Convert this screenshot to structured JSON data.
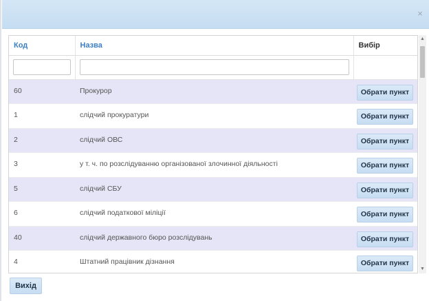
{
  "dialog": {
    "close_glyph": "×"
  },
  "table": {
    "headers": {
      "code": "Код",
      "name": "Назва",
      "choice": "Вибір"
    },
    "filters": {
      "code_value": "",
      "name_value": ""
    },
    "rows": [
      {
        "code": "60",
        "name": "Прокурор",
        "button": "Обрати пункт"
      },
      {
        "code": "1",
        "name": "слідчий прокуратури",
        "button": "Обрати пункт"
      },
      {
        "code": "2",
        "name": "слідчий ОВС",
        "button": "Обрати пункт"
      },
      {
        "code": "3",
        "name": "у т. ч. по розслідуванню організованої злочинної діяльності",
        "button": "Обрати пункт"
      },
      {
        "code": "5",
        "name": "слідчий СБУ",
        "button": "Обрати пункт"
      },
      {
        "code": "6",
        "name": "слідчий податкової міліції",
        "button": "Обрати пункт"
      },
      {
        "code": "40",
        "name": "слідчий державного бюро розслідувань",
        "button": "Обрати пункт"
      },
      {
        "code": "4",
        "name": "Штатний працівник дізнання",
        "button": "Обрати пункт"
      }
    ]
  },
  "footer": {
    "exit_label": "Вихід"
  },
  "colors": {
    "header_bg": "#c5ddf1",
    "row_alt_bg": "#e5e5f7",
    "link_blue": "#3b7fc4",
    "button_bg": "#c7ddf2"
  }
}
